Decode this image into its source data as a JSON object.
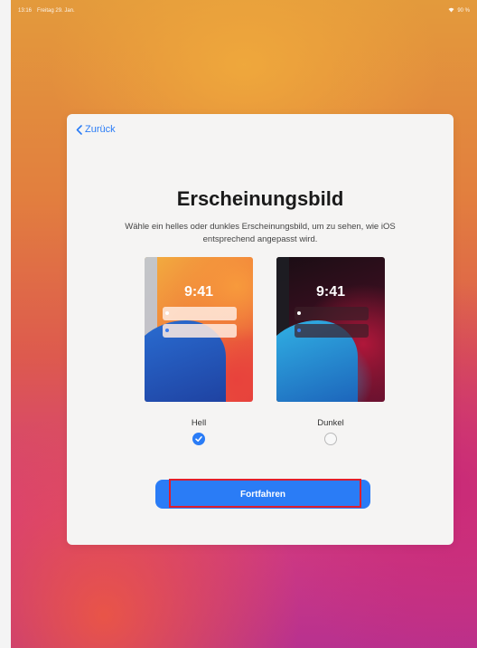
{
  "status_bar": {
    "time": "13:16",
    "date": "Freitag 29. Jan.",
    "battery": "90 %"
  },
  "nav": {
    "back_label": "Zurück"
  },
  "title": "Erscheinungsbild",
  "subtitle": "Wähle ein helles oder dunkles Erscheinungsbild, um zu sehen, wie iOS entsprechend angepasst wird.",
  "options": [
    {
      "label": "Hell",
      "clock": "9:41",
      "selected": true
    },
    {
      "label": "Dunkel",
      "clock": "9:41",
      "selected": false
    }
  ],
  "continue_label": "Fortfahren",
  "colors": {
    "accent": "#2a7cf6",
    "highlight": "#e01e2b"
  }
}
